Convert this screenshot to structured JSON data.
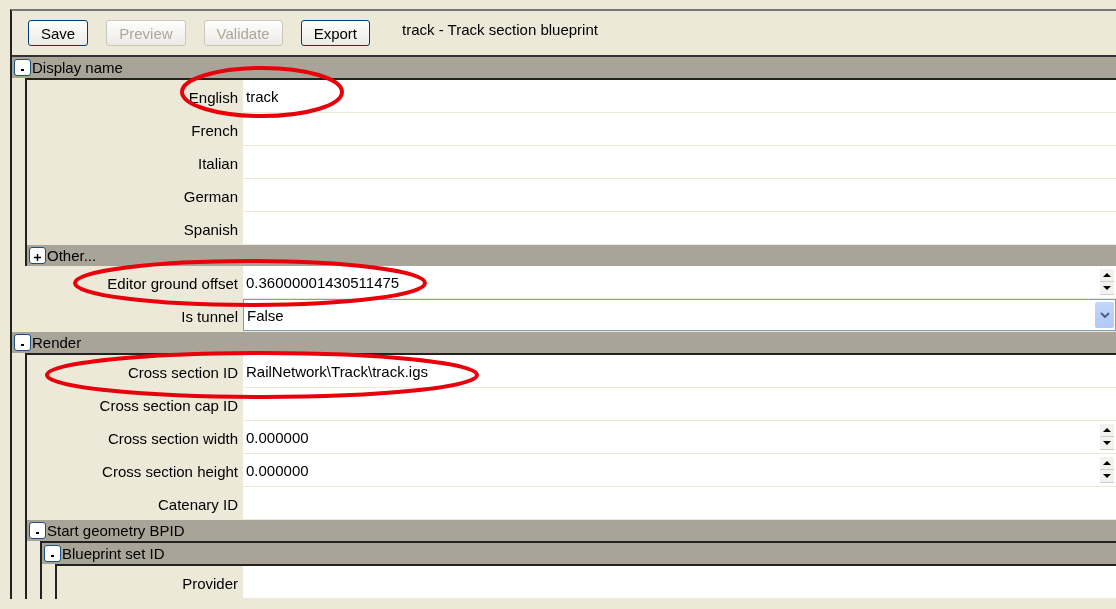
{
  "toolbar": {
    "buttons": [
      {
        "label": "Save",
        "disabled": false
      },
      {
        "label": "Preview",
        "disabled": true
      },
      {
        "label": "Validate",
        "disabled": true
      },
      {
        "label": "Export",
        "disabled": false
      }
    ],
    "title": "track - Track section blueprint"
  },
  "items": [
    {
      "kind": "section",
      "label": "Display name",
      "expanded": true,
      "children": [
        {
          "kind": "text",
          "label": "English",
          "value": "track"
        },
        {
          "kind": "text",
          "label": "French"
        },
        {
          "kind": "text",
          "label": "Italian"
        },
        {
          "kind": "text",
          "label": "German"
        },
        {
          "kind": "text",
          "label": "Spanish"
        },
        {
          "kind": "section",
          "label": "Other...",
          "expanded": false
        }
      ]
    },
    {
      "kind": "spin",
      "label": "Editor ground offset",
      "value": "0.36000001430511475"
    },
    {
      "kind": "dropdown",
      "label": "Is tunnel",
      "value": "False"
    },
    {
      "kind": "section",
      "label": "Render",
      "expanded": true,
      "children": [
        {
          "kind": "text",
          "label": "Cross section ID",
          "value": "RailNetwork\\Track\\track.igs"
        },
        {
          "kind": "text",
          "label": "Cross section cap ID"
        },
        {
          "kind": "spin",
          "label": "Cross section width",
          "value": "0.000000"
        },
        {
          "kind": "spin",
          "label": "Cross section height",
          "value": "0.000000"
        },
        {
          "kind": "text",
          "label": "Catenary ID"
        },
        {
          "kind": "section",
          "label": "Start geometry BPID",
          "expanded": true,
          "children": [
            {
              "kind": "section",
              "label": "Blueprint set ID",
              "expanded": true,
              "children": [
                {
                  "kind": "text",
                  "label": "Provider"
                }
              ]
            }
          ]
        }
      ]
    }
  ]
}
